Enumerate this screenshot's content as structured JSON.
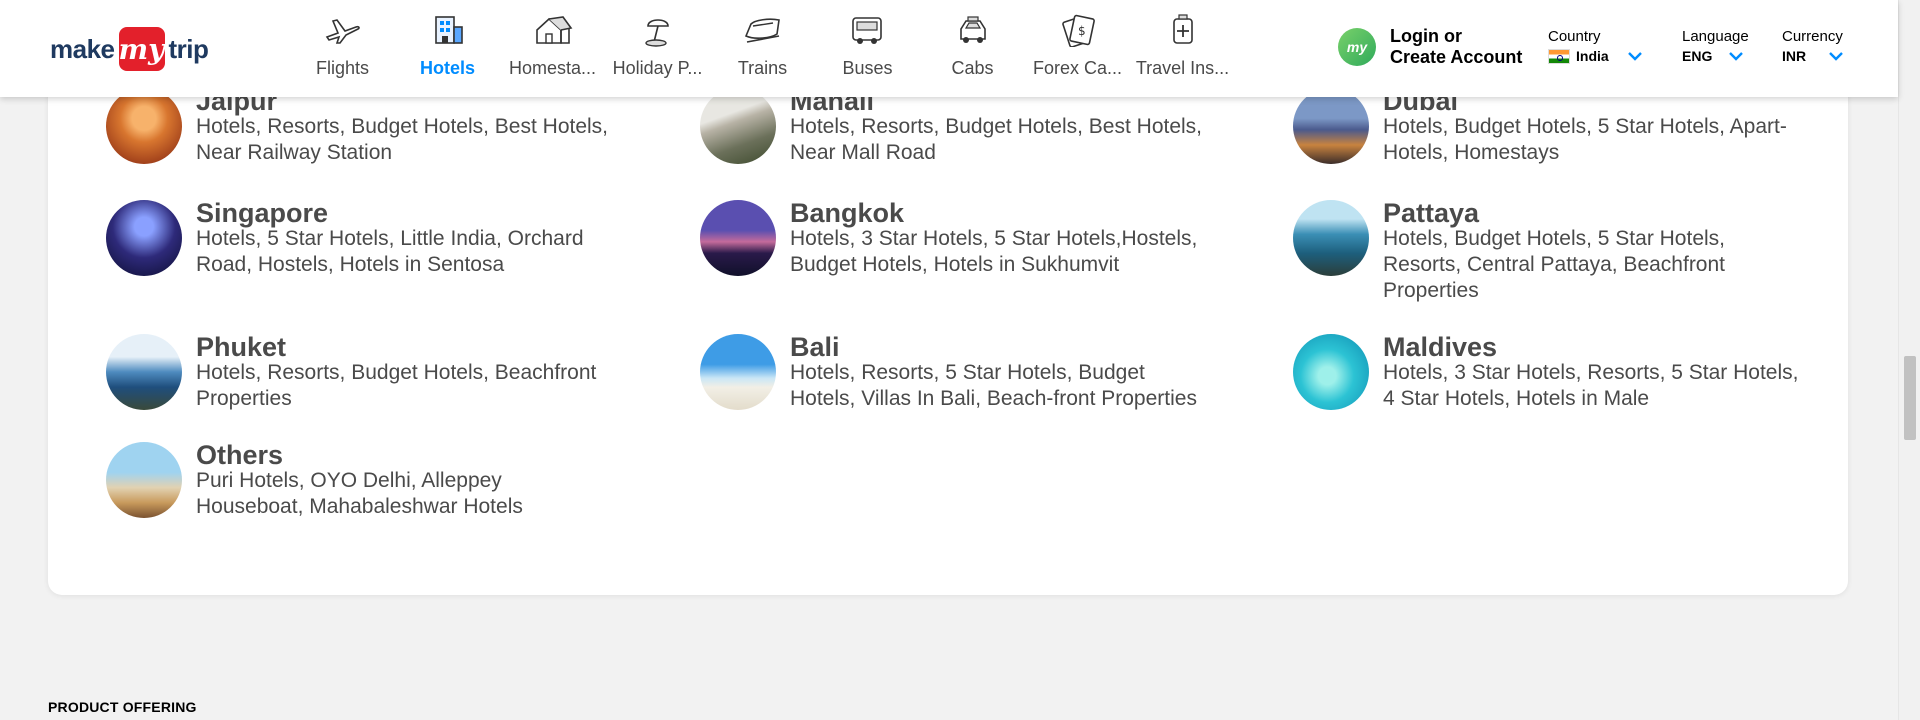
{
  "header": {
    "logo": {
      "part1": "make",
      "part2": "my",
      "part3": "trip"
    },
    "nav": [
      {
        "label": "Flights",
        "icon": "flight-icon",
        "active": false
      },
      {
        "label": "Hotels",
        "icon": "hotel-icon",
        "active": true
      },
      {
        "label": "Homesta...",
        "icon": "homestay-icon",
        "active": false
      },
      {
        "label": "Holiday P...",
        "icon": "holiday-package-icon",
        "active": false
      },
      {
        "label": "Trains",
        "icon": "train-icon",
        "active": false
      },
      {
        "label": "Buses",
        "icon": "bus-icon",
        "active": false
      },
      {
        "label": "Cabs",
        "icon": "cab-icon",
        "active": false
      },
      {
        "label": "Forex Ca...",
        "icon": "forex-card-icon",
        "active": false
      },
      {
        "label": "Travel Ins...",
        "icon": "travel-insurance-icon",
        "active": false
      }
    ],
    "login": {
      "line1": "Login or",
      "line2": "Create Account",
      "avatar_text": "my"
    },
    "country": {
      "label": "Country",
      "value": "India"
    },
    "language": {
      "label": "Language",
      "value": "ENG"
    },
    "currency": {
      "label": "Currency",
      "value": "INR"
    },
    "accent_color": "#008cff"
  },
  "cities": [
    {
      "name": "Jaipur",
      "desc": "Hotels, Resorts, Budget Hotels, Best Hotels, Near Railway Station",
      "thumb": "jaipur"
    },
    {
      "name": "Manali",
      "desc": "Hotels, Resorts, Budget Hotels, Best Hotels, Near Mall Road",
      "thumb": "manali"
    },
    {
      "name": "Dubai",
      "desc": "Hotels, Budget Hotels, 5 Star Hotels, Apart-Hotels, Homestays",
      "thumb": "dubai"
    },
    {
      "name": "Singapore",
      "desc": "Hotels, 5 Star Hotels, Little India, Orchard Road, Hostels, Hotels in Sentosa",
      "thumb": "singapore"
    },
    {
      "name": "Bangkok",
      "desc": "Hotels, 3 Star Hotels, 5 Star Hotels,Hostels, Budget Hotels, Hotels in Sukhumvit",
      "thumb": "bangkok"
    },
    {
      "name": "Pattaya",
      "desc": "Hotels, Budget Hotels, 5 Star Hotels, Resorts, Central Pattaya, Beachfront Properties",
      "thumb": "pattaya"
    },
    {
      "name": "Phuket",
      "desc": "Hotels, Resorts, Budget Hotels, Beachfront Properties",
      "thumb": "phuket"
    },
    {
      "name": "Bali",
      "desc": "Hotels, Resorts, 5 Star Hotels, Budget Hotels, Villas In Bali, Beach-front Properties",
      "thumb": "bali"
    },
    {
      "name": "Maldives",
      "desc": "Hotels, 3 Star Hotels, Resorts, 5 Star Hotels, 4 Star Hotels, Hotels in Male",
      "thumb": "maldives"
    },
    {
      "name": "Others",
      "desc": "Puri Hotels, OYO Delhi, Alleppey Houseboat, Mahabaleshwar Hotels",
      "thumb": "others"
    }
  ],
  "footer": {
    "section_title": "PRODUCT OFFERING"
  }
}
